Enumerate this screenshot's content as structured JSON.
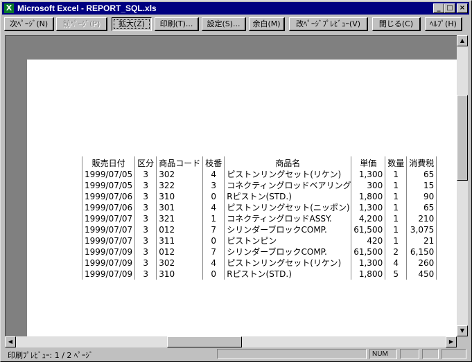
{
  "window": {
    "title": "Microsoft Excel - REPORT_SQL.xls",
    "app_icon": "excel-icon",
    "controls": {
      "minimize": "_",
      "maximize": "□",
      "close": "×"
    }
  },
  "toolbar": {
    "next": "次ﾍﾟｰｼﾞ(N)",
    "prev": "前ﾍﾟｰｼﾞ(P)",
    "zoom": "拡大(Z)",
    "print": "印刷(T)...",
    "setup": "設定(S)...",
    "margins": "余白(M)",
    "page_break": "改ﾍﾟｰｼﾞﾌﾟﾚﾋﾞｭｰ(V)",
    "close": "閉じる(C)",
    "help": "ﾍﾙﾌﾟ(H)"
  },
  "report": {
    "headers": [
      "販売日付",
      "区分",
      "商品コード",
      "枝番",
      "商品名",
      "単価",
      "数量",
      "消費税"
    ],
    "rows": [
      [
        "1999/07/05",
        "3",
        "302",
        "4",
        "ピストンリングセット(リケン)",
        "1,300",
        "1",
        "65"
      ],
      [
        "1999/07/05",
        "3",
        "322",
        "3",
        "コネクティングロッドベアリング",
        "300",
        "1",
        "15"
      ],
      [
        "1999/07/06",
        "3",
        "310",
        "0",
        "Rピストン(STD.)",
        "1,800",
        "1",
        "90"
      ],
      [
        "1999/07/06",
        "3",
        "301",
        "4",
        "ピストンリングセット(ニッポン)",
        "1,300",
        "1",
        "65"
      ],
      [
        "1999/07/07",
        "3",
        "321",
        "1",
        "コネクティングロッドASSY.",
        "4,200",
        "1",
        "210"
      ],
      [
        "1999/07/07",
        "3",
        "012",
        "7",
        "シリンダーブロックCOMP.",
        "61,500",
        "1",
        "3,075"
      ],
      [
        "1999/07/07",
        "3",
        "311",
        "0",
        "ピストンピン",
        "420",
        "1",
        "21"
      ],
      [
        "1999/07/09",
        "3",
        "012",
        "7",
        "シリンダーブロックCOMP.",
        "61,500",
        "2",
        "6,150"
      ],
      [
        "1999/07/09",
        "3",
        "302",
        "4",
        "ピストンリングセット(リケン)",
        "1,300",
        "4",
        "260"
      ],
      [
        "1999/07/09",
        "3",
        "310",
        "0",
        "Rピストン(STD.)",
        "1,800",
        "5",
        "450"
      ]
    ]
  },
  "scroll": {
    "up": "▲",
    "down": "▼",
    "left": "◀",
    "right": "▶"
  },
  "status": {
    "text": "印刷ﾌﾟﾚﾋﾞｭｰ: 1 / 2 ﾍﾟｰｼﾞ",
    "num": "NUM"
  }
}
